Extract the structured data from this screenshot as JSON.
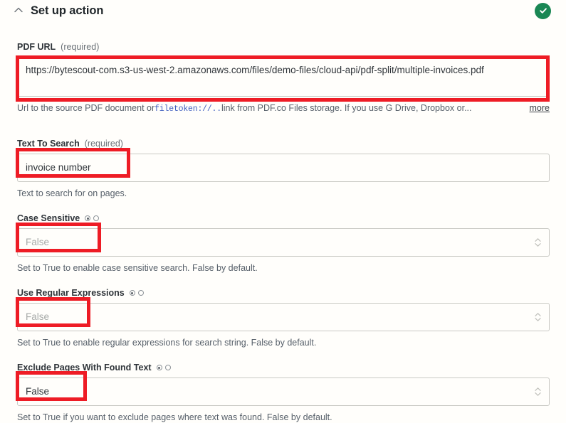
{
  "header": {
    "collapse_icon": "chevron-up-icon",
    "title": "Set up action",
    "status_icon": "check-circle-icon",
    "status_color": "#1a8754"
  },
  "fields": [
    {
      "label": "PDF URL",
      "required_note": "(required)",
      "control": "textarea",
      "value": "https://bytescout-com.s3-us-west-2.amazonaws.com/files/demo-files/cloud-api/pdf-split/multiple-invoices.pdf",
      "is_placeholder": false,
      "help_prefix": "Url to the source PDF document or ",
      "help_mono": "filetoken://..",
      "help_suffix": " link from PDF.co Files storage. If you use G Drive, Dropbox or...",
      "more_label": "more"
    },
    {
      "label": "Text To Search",
      "required_note": "(required)",
      "control": "text",
      "value": "invoice number",
      "is_placeholder": false,
      "help": "Text to search for on pages."
    },
    {
      "label": "Case Sensitive",
      "required_note": "",
      "control": "select",
      "value": "False",
      "is_placeholder": true,
      "help": "Set to True to enable case sensitive search. False by default."
    },
    {
      "label": "Use Regular Expressions",
      "required_note": "",
      "control": "select",
      "value": "False",
      "is_placeholder": true,
      "help": "Set to True to enable regular expressions for search string. False by default."
    },
    {
      "label": "Exclude Pages With Found Text",
      "required_note": "",
      "control": "select",
      "value": "False",
      "is_placeholder": false,
      "help": "Set to True if you want to exclude pages where text was found. False by default."
    }
  ],
  "annotation": {
    "color": "#ee1c25",
    "count": 5
  }
}
